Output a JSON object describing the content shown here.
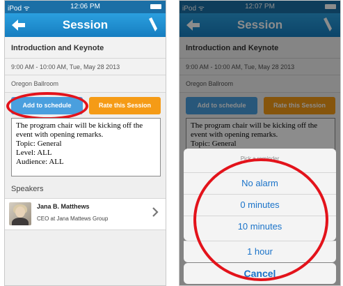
{
  "left": {
    "status": {
      "carrier": "iPod ᯤ",
      "time": "12:06 PM"
    },
    "nav": {
      "title": "Session"
    },
    "session": {
      "title": "Introduction and Keynote",
      "time": "9:00 AM - 10:00 AM, Tue, May 28 2013",
      "location": "Oregon Ballroom"
    },
    "buttons": {
      "add": "Add to schedule",
      "rate": "Rate this Session"
    },
    "description": [
      "The program chair will be kicking off the",
      "event with opening remarks.",
      "Topic: General",
      "Level: ALL",
      "Audience: ALL"
    ],
    "speakers_header": "Speakers",
    "speaker": {
      "name": "Jana B. Matthews",
      "role": "CEO at Jana Mattews Group"
    }
  },
  "right": {
    "status": {
      "carrier": "iPod ᯤ",
      "time": "12:07 PM"
    },
    "nav": {
      "title": "Session"
    },
    "session": {
      "title": "Introduction and Keynote",
      "time": "9:00 AM - 10:00 AM, Tue, May 28 2013",
      "location": "Oregon Ballroom"
    },
    "buttons": {
      "add": "Add to schedule",
      "rate": "Rate this Session"
    },
    "description": [
      "The program chair will be kicking off the",
      "event with opening remarks.",
      "Topic: General"
    ],
    "sheet": {
      "title": "Pick a reminder",
      "options": [
        "No alarm",
        "0 minutes",
        "10 minutes",
        "1 hour"
      ],
      "cancel": "Cancel"
    }
  },
  "colors": {
    "nav": "#1b86c8",
    "add_button": "#4a9fde",
    "rate_button": "#f59b16",
    "highlight": "#e3131b",
    "action_text": "#1a73c9"
  }
}
